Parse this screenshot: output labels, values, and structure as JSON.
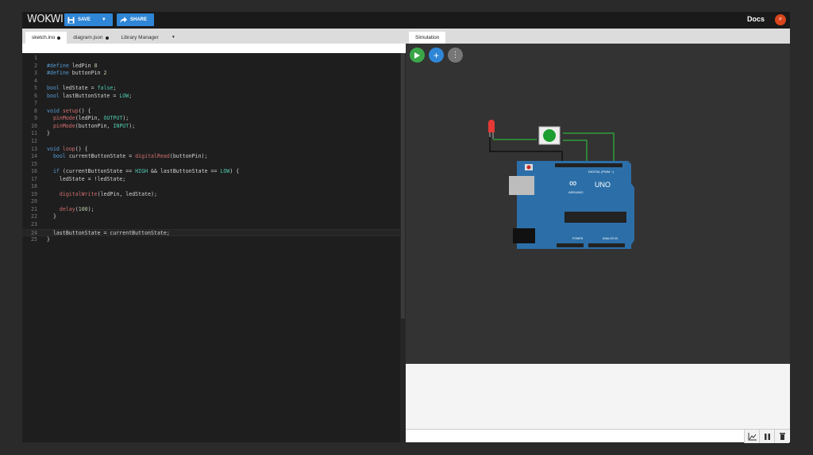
{
  "header": {
    "logo": "WOKWI",
    "save_label": "SAVE",
    "share_label": "SHARE",
    "docs_label": "Docs",
    "avatar_initial": "P"
  },
  "editor": {
    "tabs": [
      {
        "label": "sketch.ino",
        "modified": true
      },
      {
        "label": "diagram.json",
        "modified": true
      },
      {
        "label": "Library Manager"
      }
    ],
    "active_line": 24,
    "lines": [
      "",
      "#define ledPin 8",
      "#define buttonPin 2",
      "",
      "bool ledState = false;",
      "bool lastButtonState = LOW;",
      "",
      "void setup() {",
      "  pinMode(ledPin, OUTPUT);",
      "  pinMode(buttonPin, INPUT);",
      "}",
      "",
      "void loop() {",
      "  bool currentButtonState = digitalRead(buttonPin);",
      "",
      "  if (currentButtonState == HIGH && lastButtonState == LOW) {",
      "    ledState = !ledState;",
      "",
      "    digitalWrite(ledPin, ledState);",
      "",
      "    delay(100);",
      "  }",
      "",
      "  lastButtonState = currentButtonState;",
      "}"
    ]
  },
  "simulation": {
    "tab_label": "Simulation",
    "board_label": "UNO",
    "board_brand": "ARDUINO",
    "board_header": "DIGITAL (PWM ~)",
    "board_analog": "ANALOG IN",
    "board_power": "POWER",
    "colors": {
      "play": "#3aa648",
      "add": "#2f86d6",
      "more": "#777777",
      "board": "#2c6fa8",
      "wire": "#2e9d3a",
      "led": "#e53935",
      "button": "#1b9e2f"
    }
  },
  "colors": {
    "accent": "#2f86d6"
  }
}
